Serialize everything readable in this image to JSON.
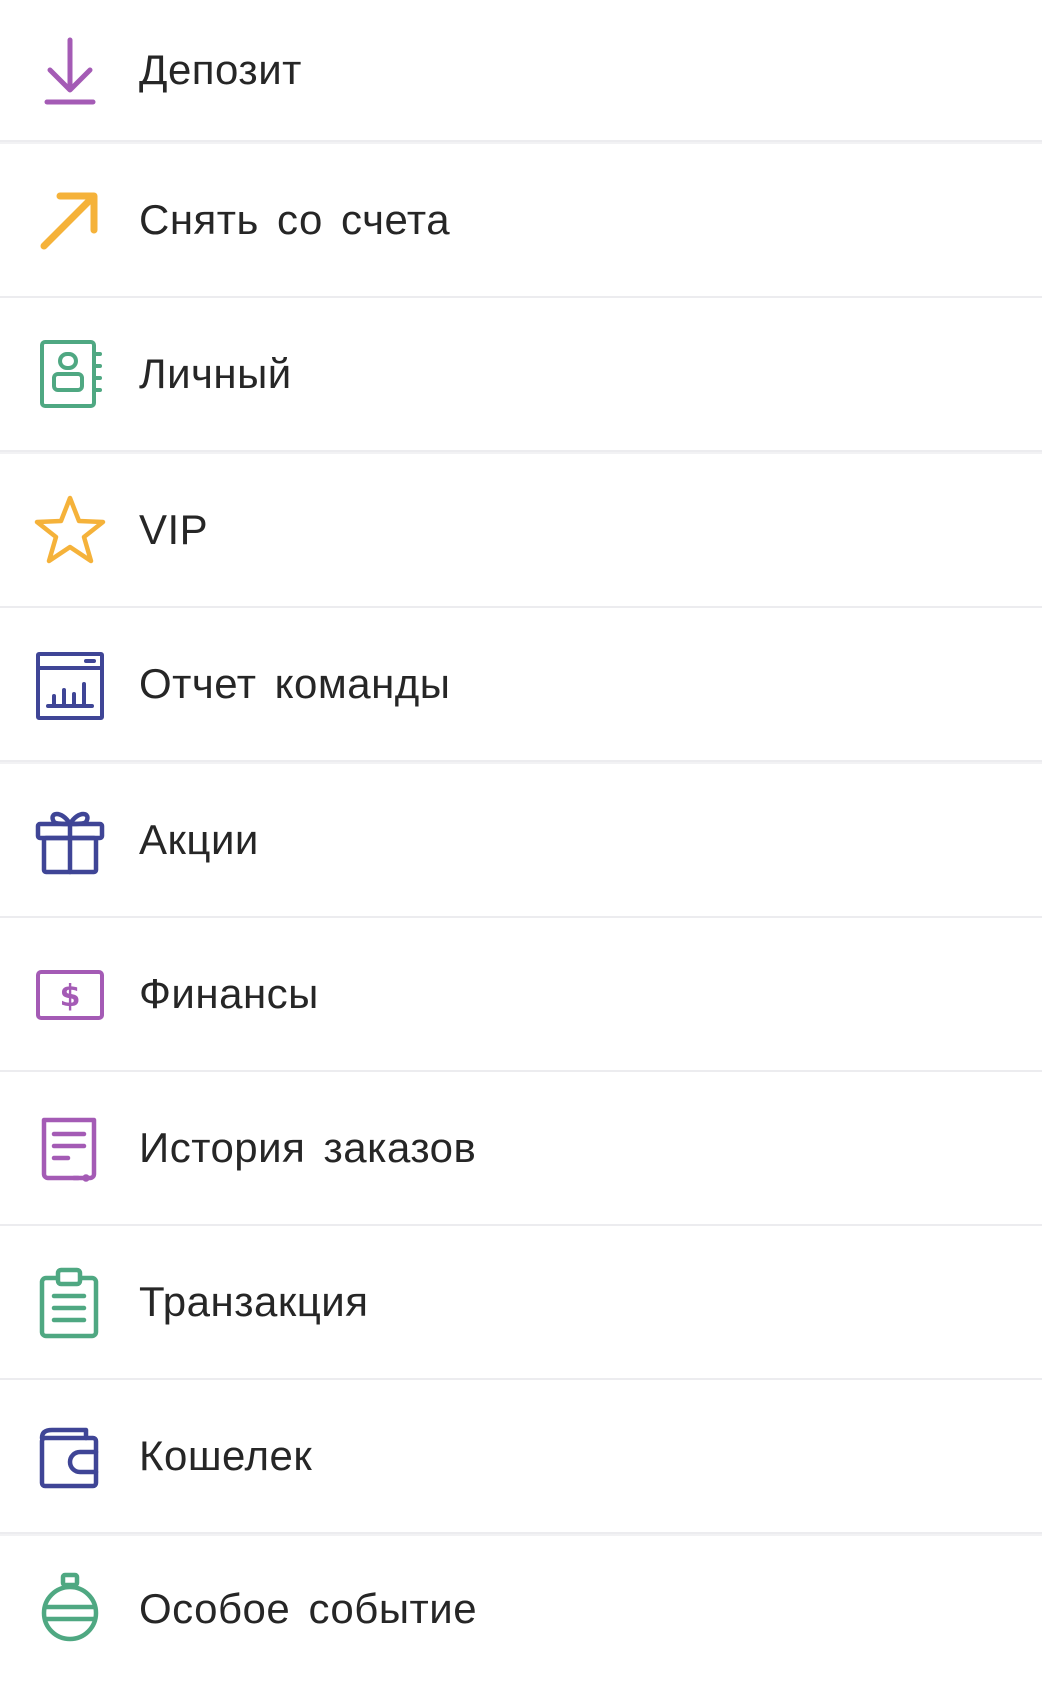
{
  "menu": {
    "items": [
      {
        "id": "deposit",
        "label": "Депозит",
        "icon": "download-arrow-icon",
        "color": "#a45bb5"
      },
      {
        "id": "withdraw",
        "label": "Снять со счета",
        "icon": "arrow-up-right-icon",
        "color": "#f5b23a"
      },
      {
        "id": "personal",
        "label": "Личный",
        "icon": "contact-book-icon",
        "color": "#4fa882"
      },
      {
        "id": "vip",
        "label": "VIP",
        "icon": "star-icon",
        "color": "#f5b23a"
      },
      {
        "id": "team-report",
        "label": "Отчет команды",
        "icon": "chart-window-icon",
        "color": "#3f4596"
      },
      {
        "id": "promotions",
        "label": "Акции",
        "icon": "gift-icon",
        "color": "#3f4596"
      },
      {
        "id": "finance",
        "label": "Финансы",
        "icon": "dollar-bill-icon",
        "color": "#a45bb5"
      },
      {
        "id": "order-history",
        "label": "История заказов",
        "icon": "document-list-icon",
        "color": "#a45bb5"
      },
      {
        "id": "transaction",
        "label": "Транзакция",
        "icon": "clipboard-icon",
        "color": "#4fa882"
      },
      {
        "id": "wallet",
        "label": "Кошелек",
        "icon": "wallet-icon",
        "color": "#3f4596"
      },
      {
        "id": "special-event",
        "label": "Особое событие",
        "icon": "ornament-icon",
        "color": "#4fa882"
      }
    ]
  }
}
